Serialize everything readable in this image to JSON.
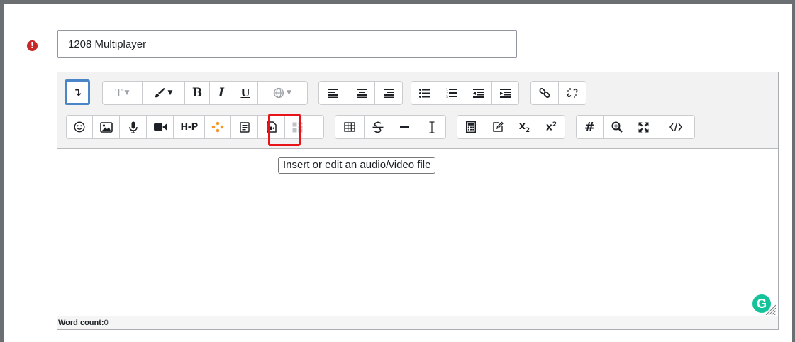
{
  "form": {
    "error_icon": "!",
    "name_value": "1208 Multiplayer"
  },
  "toolbar": {
    "collapse": "↴",
    "font_size": "T",
    "bold": "B",
    "italic": "I",
    "underline": "U",
    "h5p": "H-P",
    "subscript": "x",
    "subscript_sub": "2",
    "superscript": "x",
    "superscript_sup": "2",
    "hash": "#"
  },
  "tooltip": {
    "text": "Insert or edit an audio/video file"
  },
  "status": {
    "label": "Word count:",
    "value": "0"
  },
  "grammarly": {
    "letter": "G"
  },
  "colors": {
    "accent": "#0f6cbf",
    "highlight": "#e8141a",
    "error": "#c62828",
    "grammarly": "#15c39a"
  }
}
